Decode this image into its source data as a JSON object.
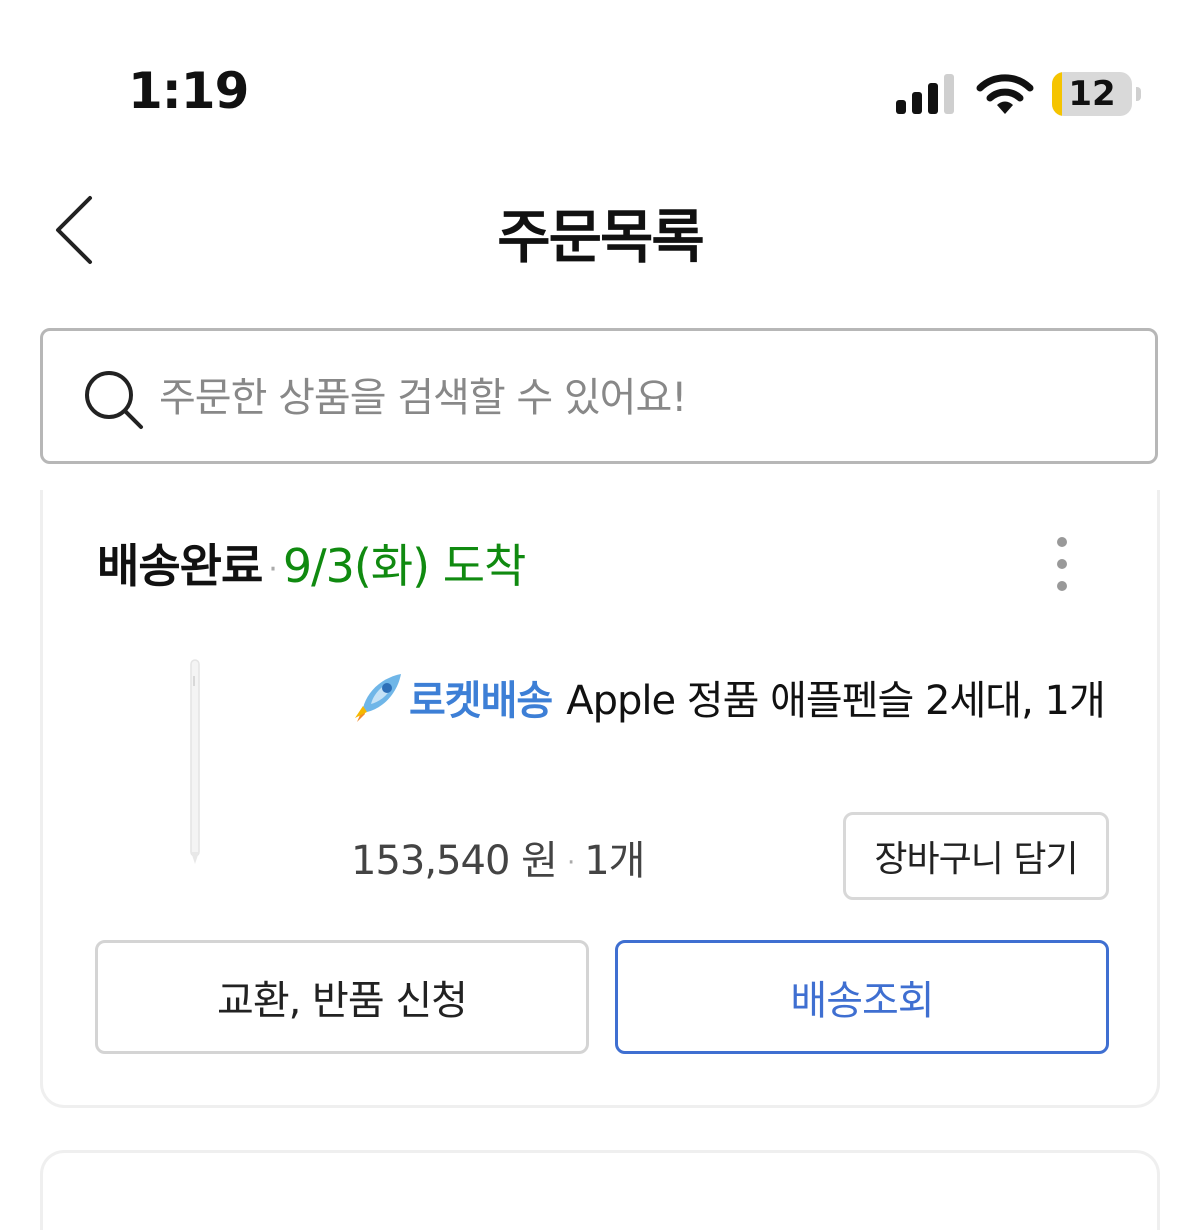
{
  "status_bar": {
    "time": "1:19",
    "battery_level": "12",
    "battery_fraction": 0.12,
    "icons": [
      "signal-icon",
      "wifi-icon",
      "battery-icon"
    ]
  },
  "header": {
    "title": "주문목록",
    "back_icon": "chevron-left-icon"
  },
  "search": {
    "placeholder": "주문한 상품을 검색할 수 있어요!",
    "icon": "search-icon"
  },
  "order": {
    "status": "배송완료",
    "separator": "·",
    "arrival": "9/3(화) 도착",
    "more_icon": "more-vertical-icon",
    "product": {
      "image_icon": "apple-pencil-image",
      "badge_icon": "rocket-icon",
      "badge_label": "로켓배송",
      "name": "Apple 정품 애플펜슬 2세대, 1개",
      "price": "153,540 원",
      "quantity": "1개"
    },
    "cart_button": "장바구니 담기",
    "return_button": "교환, 반품 신청",
    "tracking_button": "배송조회"
  },
  "colors": {
    "arrival_green": "#108a10",
    "rocket_blue": "#3d7fd6",
    "tracking_blue": "#3f6fd1",
    "battery_yellow": "#f5c400"
  }
}
